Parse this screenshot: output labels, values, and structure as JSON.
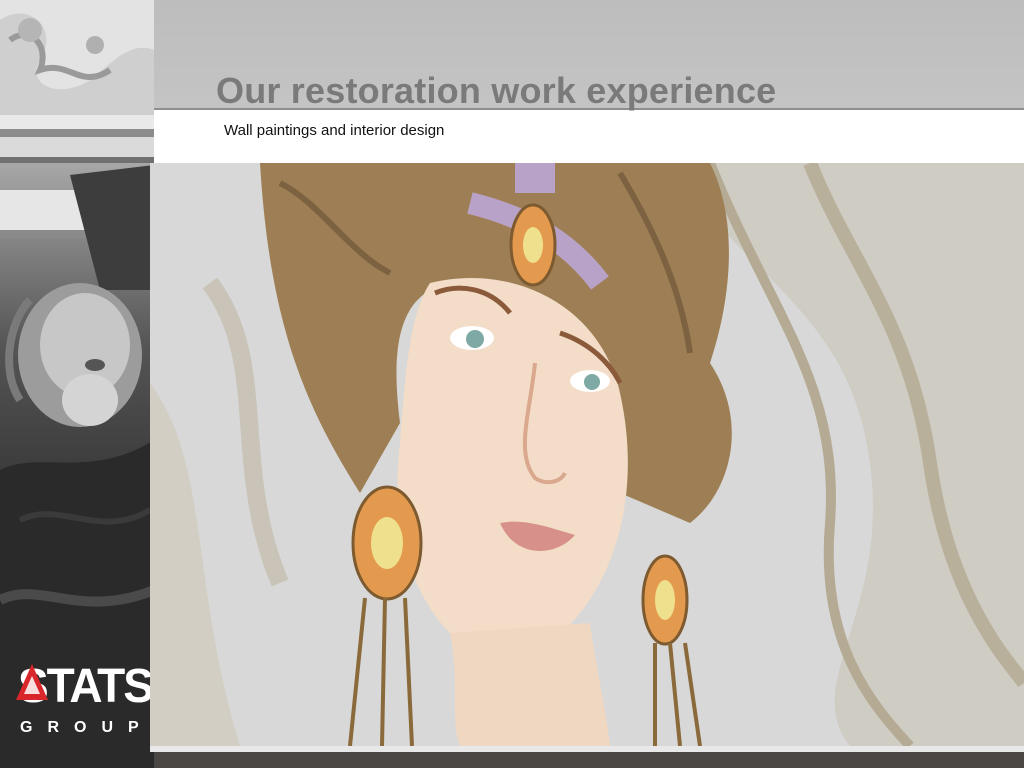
{
  "slide": {
    "title": "Our restoration work experience",
    "subtitle": "Wall paintings and interior design"
  },
  "logo": {
    "word": "STATS",
    "sub": "GROUP"
  },
  "colors": {
    "header_band": "#c0c0c0",
    "title_text": "#7a7a7a",
    "bottom_band": "#4a4744",
    "logo_accent": "#d9262b"
  },
  "images": {
    "left": "grayscale photo of ornate architectural plaster moulding with a carved lion head",
    "main": "art nouveau wall painting of a woman's face with brown updo hair, lilac headband with orange medallion and orange drop earrings"
  }
}
